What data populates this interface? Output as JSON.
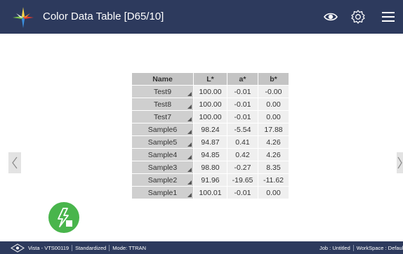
{
  "header": {
    "title": "Color Data Table [D65/10]",
    "icons": [
      "visibility-icon",
      "settings-icon",
      "menu-icon"
    ]
  },
  "table": {
    "columns": [
      "Name",
      "L*",
      "a*",
      "b*"
    ],
    "rows": [
      {
        "name": "Test9",
        "L": "100.00",
        "a": "-0.01",
        "b": "-0.00"
      },
      {
        "name": "Test8",
        "L": "100.00",
        "a": "-0.01",
        "b": "0.00"
      },
      {
        "name": "Test7",
        "L": "100.00",
        "a": "-0.01",
        "b": "0.00"
      },
      {
        "name": "Sample6",
        "L": "98.24",
        "a": "-5.54",
        "b": "17.88"
      },
      {
        "name": "Sample5",
        "L": "94.87",
        "a": "0.41",
        "b": "4.26"
      },
      {
        "name": "Sample4",
        "L": "94.85",
        "a": "0.42",
        "b": "4.26"
      },
      {
        "name": "Sample3",
        "L": "98.80",
        "a": "-0.27",
        "b": "8.35"
      },
      {
        "name": "Sample2",
        "L": "91.96",
        "a": "-19.65",
        "b": "-11.62"
      },
      {
        "name": "Sample1",
        "L": "100.01",
        "a": "-0.01",
        "b": "0.00"
      }
    ]
  },
  "status": {
    "device": "Vista - VTS00119",
    "state": "Standardized",
    "mode": "Mode: TTRAN",
    "job": "Job : Untitled",
    "workspace": "WorkSpace : Default"
  },
  "colors": {
    "bar": "#2d3a5d",
    "action": "#49b54c",
    "header_cell": "#c4c4c4",
    "name_cell": "#cfcfcf",
    "value_cell": "#efefef"
  }
}
